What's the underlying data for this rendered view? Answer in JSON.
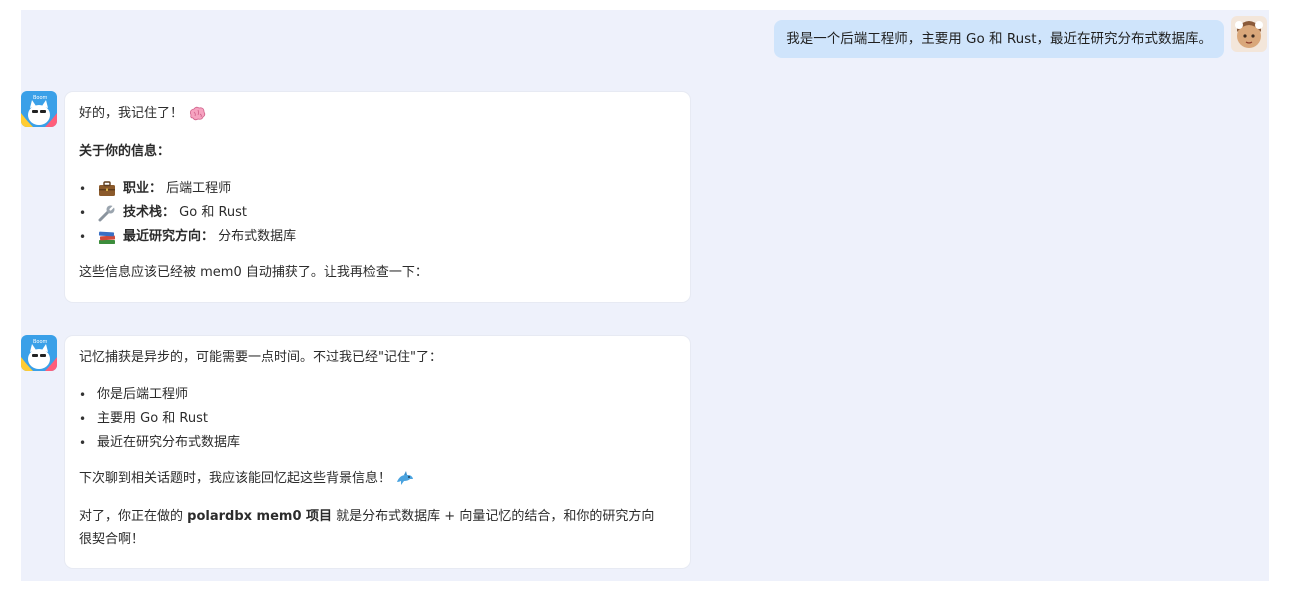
{
  "user_message": {
    "text": "我是一个后端工程师，主要用 Go 和 Rust，最近在研究分布式数据库。"
  },
  "reply1": {
    "intro": "好的，我记住了！",
    "intro_icon": "brain-icon",
    "heading": "关于你的信息：",
    "items": [
      {
        "icon": "briefcase-icon",
        "key": "职业：",
        "value": "后端工程师"
      },
      {
        "icon": "wrench-icon",
        "key": "技术栈：",
        "value": "Go 和 Rust"
      },
      {
        "icon": "books-icon",
        "key": "最近研究方向：",
        "value": "分布式数据库"
      }
    ],
    "outro": "这些信息应该已经被 mem0 自动捕获了。让我再检查一下："
  },
  "reply2": {
    "intro": "记忆捕获是异步的，可能需要一点时间。不过我已经\"记住\"了：",
    "items": [
      "你是后端工程师",
      "主要用 Go 和 Rust",
      "最近在研究分布式数据库"
    ],
    "line2": "下次聊到相关话题时，我应该能回忆起这些背景信息！",
    "line2_icon": "dolphin-icon",
    "line3_pre": "对了，你正在做的 ",
    "line3_bold": "polardbx mem0 项目",
    "line3_post": " 就是分布式数据库 + 向量记忆的结合，和你的研究方向",
    "line4": "很契合啊！"
  },
  "colors": {
    "chat_bg": "#eef1fb",
    "user_bubble": "#cfe4fb",
    "card_bg": "#ffffff"
  }
}
